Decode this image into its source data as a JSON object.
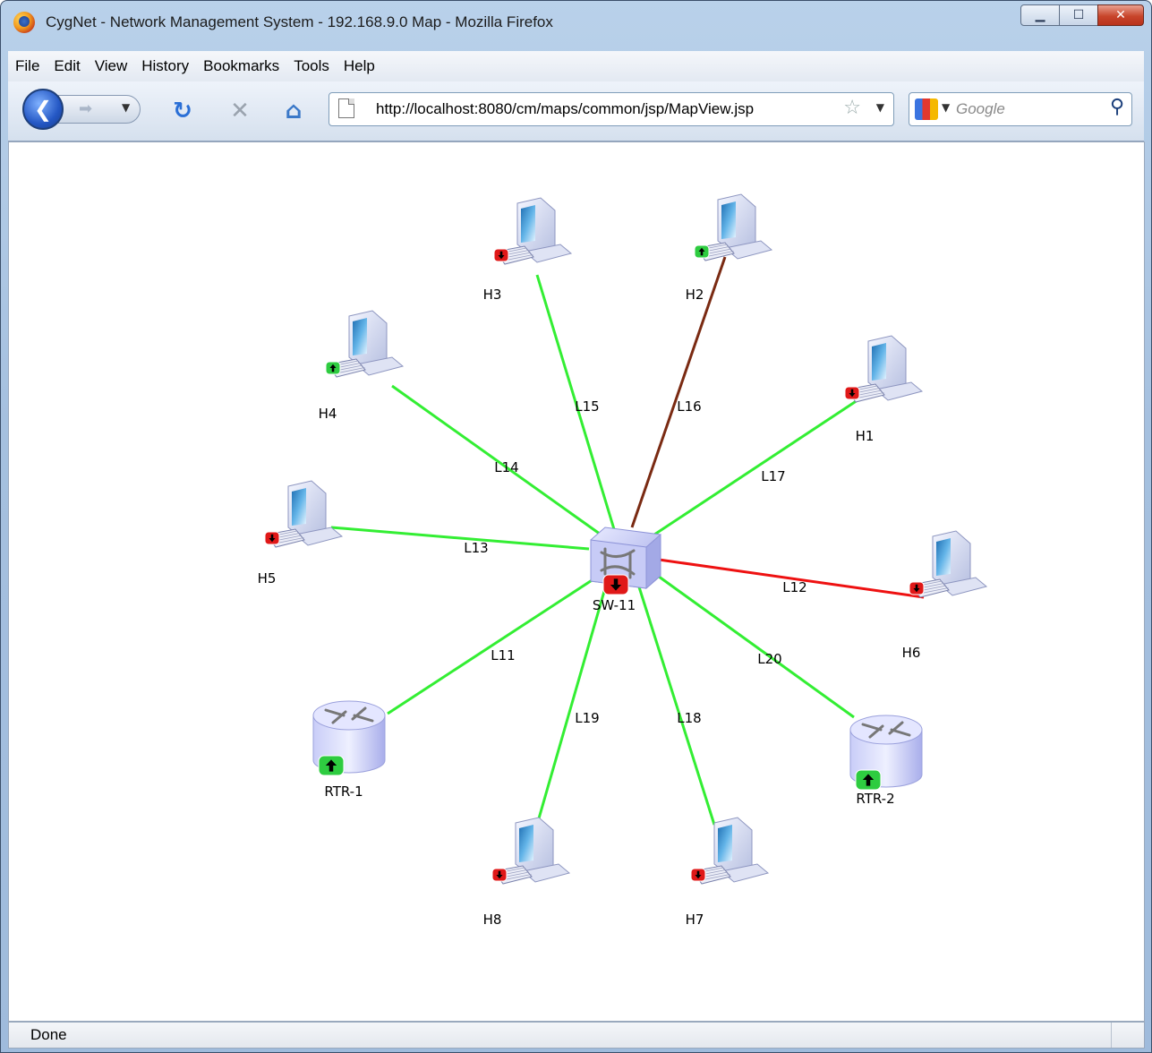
{
  "window": {
    "title": "CygNet - Network Management System - 192.168.9.0 Map - Mozilla Firefox"
  },
  "menu": [
    "File",
    "Edit",
    "View",
    "History",
    "Bookmarks",
    "Tools",
    "Help"
  ],
  "toolbar": {
    "url": "http://localhost:8080/cm/maps/common/jsp/MapView.jsp",
    "search_placeholder": "Google"
  },
  "status": {
    "text": "Done"
  },
  "map": {
    "nodes": [
      {
        "id": "SW-11",
        "label": "SW-11",
        "type": "switch",
        "status": "down"
      },
      {
        "id": "H1",
        "label": "H1",
        "type": "host",
        "status": "down"
      },
      {
        "id": "H2",
        "label": "H2",
        "type": "host",
        "status": "up"
      },
      {
        "id": "H3",
        "label": "H3",
        "type": "host",
        "status": "down"
      },
      {
        "id": "H4",
        "label": "H4",
        "type": "host",
        "status": "up"
      },
      {
        "id": "H5",
        "label": "H5",
        "type": "host",
        "status": "down"
      },
      {
        "id": "H6",
        "label": "H6",
        "type": "host",
        "status": "down"
      },
      {
        "id": "H7",
        "label": "H7",
        "type": "host",
        "status": "down"
      },
      {
        "id": "H8",
        "label": "H8",
        "type": "host",
        "status": "down"
      },
      {
        "id": "RTR-1",
        "label": "RTR-1",
        "type": "router",
        "status": "up"
      },
      {
        "id": "RTR-2",
        "label": "RTR-2",
        "type": "router",
        "status": "up"
      }
    ],
    "links": [
      {
        "label": "L11",
        "from": "SW-11",
        "to": "RTR-1",
        "color": "#33ee33"
      },
      {
        "label": "L12",
        "from": "SW-11",
        "to": "H6",
        "color": "#ee1111"
      },
      {
        "label": "L13",
        "from": "SW-11",
        "to": "H5",
        "color": "#33ee33"
      },
      {
        "label": "L14",
        "from": "SW-11",
        "to": "H4",
        "color": "#33ee33"
      },
      {
        "label": "L15",
        "from": "SW-11",
        "to": "H3",
        "color": "#33ee33"
      },
      {
        "label": "L16",
        "from": "SW-11",
        "to": "H2",
        "color": "#7a2a12"
      },
      {
        "label": "L17",
        "from": "SW-11",
        "to": "H1",
        "color": "#33ee33"
      },
      {
        "label": "L18",
        "from": "SW-11",
        "to": "H7",
        "color": "#33ee33"
      },
      {
        "label": "L19",
        "from": "SW-11",
        "to": "H8",
        "color": "#33ee33"
      },
      {
        "label": "L20",
        "from": "SW-11",
        "to": "RTR-2",
        "color": "#33ee33"
      }
    ],
    "status_colors": {
      "up": "#2ecc40",
      "down": "#e01818"
    }
  }
}
